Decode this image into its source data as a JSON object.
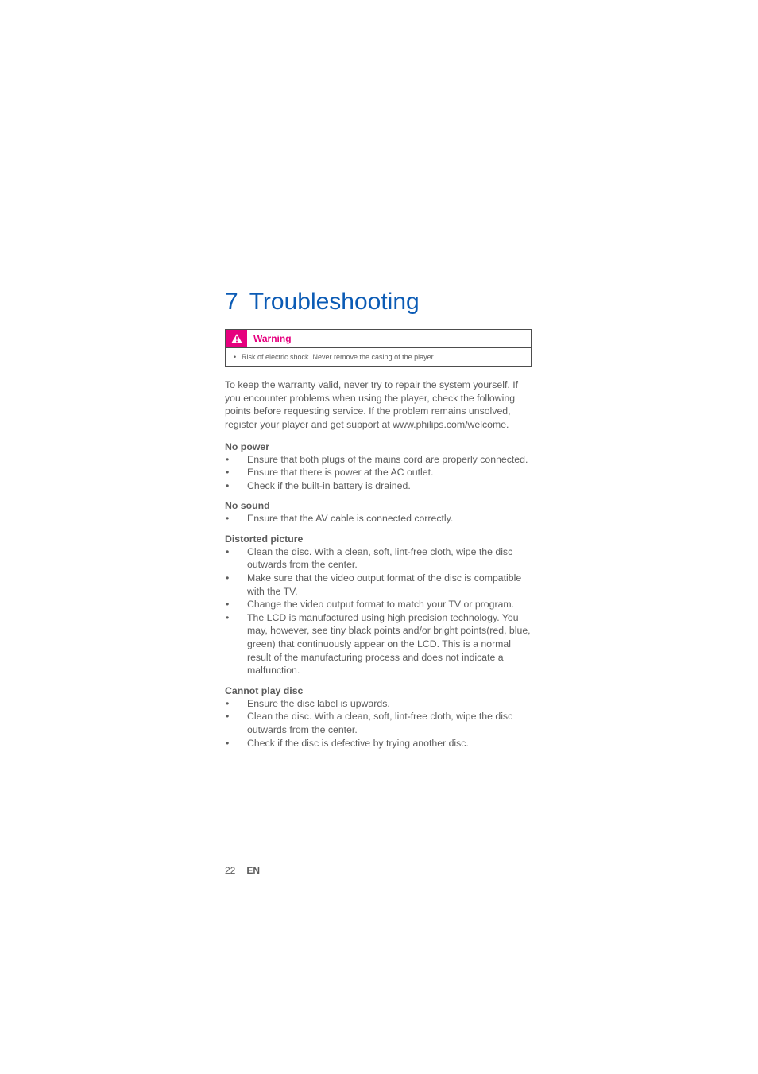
{
  "chapter": {
    "number": "7",
    "title": "Troubleshooting"
  },
  "warning": {
    "label": "Warning",
    "text": "Risk of electric shock. Never remove the casing of the player."
  },
  "intro": "To keep the warranty valid, never try to repair the system yourself.\nIf you encounter problems when using the player, check the following points before requesting service. If the problem remains unsolved, register your player and get support at www.philips.com/welcome.",
  "sections": [
    {
      "heading": "No power",
      "items": [
        "Ensure that both plugs of the mains cord are properly connected.",
        "Ensure that there is power at the AC outlet.",
        "Check if the built-in battery is drained."
      ]
    },
    {
      "heading": "No sound",
      "items": [
        "Ensure that the AV cable is connected correctly."
      ]
    },
    {
      "heading": "Distorted picture",
      "items": [
        "Clean the disc. With a clean, soft, lint-free cloth, wipe the disc outwards from the center.",
        "Make sure that the video output format of the disc is compatible with the TV.",
        "Change the video output format to match your TV or program.",
        "The LCD is manufactured using high precision technology. You may, however, see tiny black points and/or bright points(red, blue, green) that continuously appear on the LCD. This is a normal result of the manufacturing process and does not indicate a malfunction."
      ]
    },
    {
      "heading": "Cannot play disc",
      "items": [
        "Ensure the disc label is upwards.",
        "Clean the disc. With a clean, soft, lint-free cloth, wipe the disc outwards from the center.",
        "Check if the disc is defective by trying another disc."
      ]
    }
  ],
  "footer": {
    "page": "22",
    "lang": "EN"
  }
}
